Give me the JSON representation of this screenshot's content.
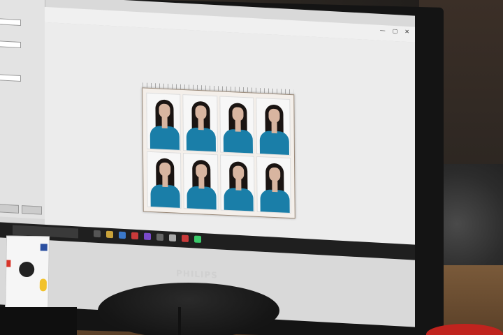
{
  "scene": {
    "monitor_brand": "PHILIPS",
    "photo_count": 8,
    "photo_grid": {
      "rows": 2,
      "cols": 4
    },
    "colors": {
      "shirt": "#1a7ea8",
      "hair": "#1a1412",
      "skin": "#d8b5a0",
      "photo_bg": "#f7f7f7",
      "taskbar": "#1f1f1f",
      "mug": "#c0231e"
    }
  }
}
